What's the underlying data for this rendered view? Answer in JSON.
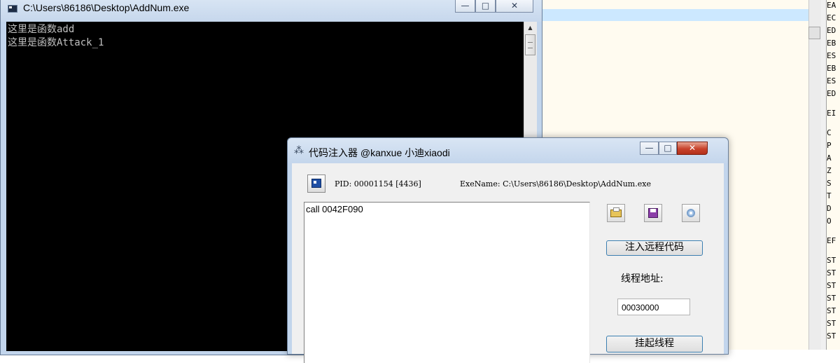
{
  "debugger": {
    "registers": [
      "EA",
      "EC",
      "ED",
      "EB",
      "ES",
      "EB",
      "ES",
      "ED",
      "EI",
      "C",
      "P",
      "A",
      "Z",
      "S",
      "T",
      "D",
      "O",
      "EF",
      "ST",
      "ST",
      "ST",
      "ST",
      "ST",
      "ST",
      "ST"
    ]
  },
  "console": {
    "title": "C:\\Users\\86186\\Desktop\\AddNum.exe",
    "lines": [
      "这里是函数add",
      "这里是函数Attack_1"
    ],
    "minimize_glyph": "—",
    "maximize_glyph": "□",
    "close_glyph": "✕"
  },
  "injector": {
    "title": "代码注入器 @kanxue 小迪xiaodi",
    "pid_label": "PID: 00001154 [4436]",
    "exename_label": "ExeName: C:\\Users\\86186\\Desktop\\AddNum.exe",
    "code": "call 0042F090",
    "inject_button": "注入远程代码",
    "thread_address_label": "线程地址:",
    "thread_address_value": "00030000",
    "suspend_button": "挂起线程",
    "minimize_glyph": "—",
    "maximize_glyph": "□",
    "close_glyph": "✕"
  },
  "colors": {
    "console_bg": "#000000",
    "console_text": "#c0c0c0",
    "title_bar": "#c2d5ec",
    "close_button": "#c8432c",
    "debugger_bg": "#fffbf0",
    "selection": "#cce8ff"
  }
}
